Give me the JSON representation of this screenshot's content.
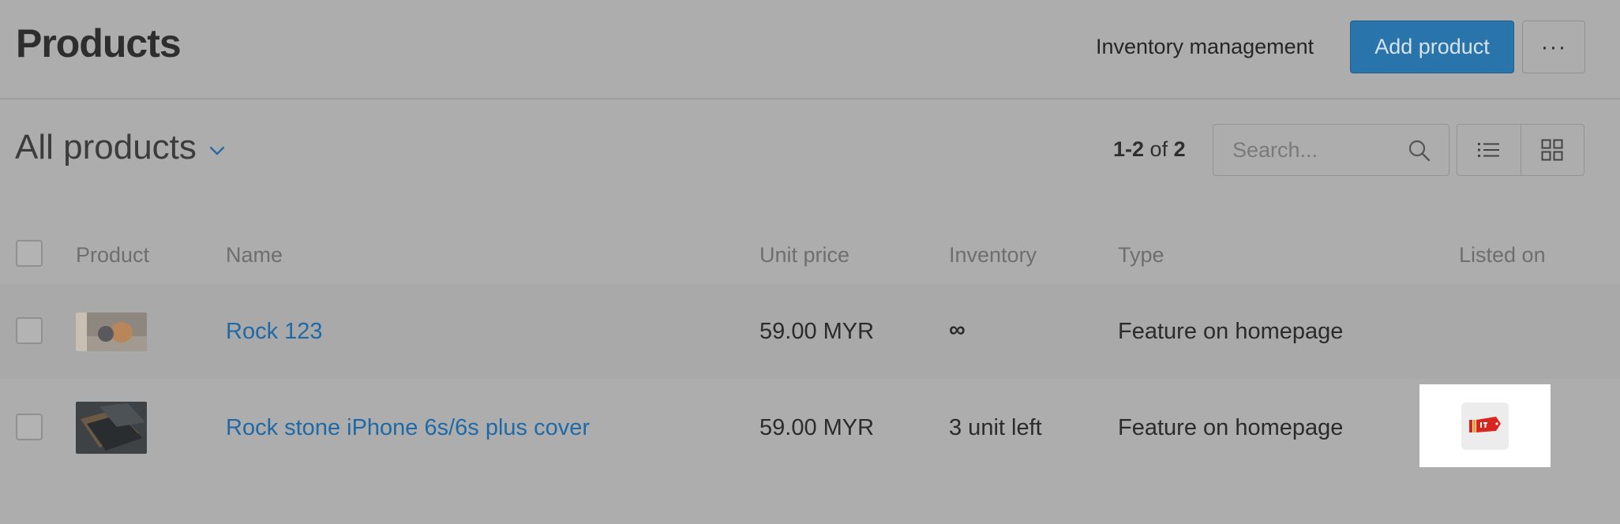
{
  "header": {
    "title": "Products",
    "inventory_link": "Inventory management",
    "add_button": "Add product",
    "more_button": "···"
  },
  "filter": {
    "title": "All products",
    "pager": {
      "range": "1-2",
      "of": "of",
      "total": "2"
    },
    "search_placeholder": "Search..."
  },
  "table": {
    "columns": {
      "product": "Product",
      "name": "Name",
      "unit_price": "Unit price",
      "inventory": "Inventory",
      "type": "Type",
      "listed_on": "Listed on"
    },
    "rows": [
      {
        "name": "Rock 123",
        "unit_price": "59.00 MYR",
        "inventory": "∞",
        "type": "Feature on homepage",
        "listed_on": ""
      },
      {
        "name": "Rock stone iPhone 6s/6s plus cover",
        "unit_price": "59.00 MYR",
        "inventory": "3 unit left",
        "type": "Feature on homepage",
        "listed_on": "channel-logo"
      }
    ]
  },
  "colors": {
    "accent": "#2a74ac",
    "link": "#1f6aa6",
    "overlay_background": "#adadad",
    "channel_red": "#d7261e"
  },
  "icons": {
    "more": "more-icon",
    "chevron": "chevron-down-icon",
    "search": "search-icon",
    "list_view": "list-view-icon",
    "grid_view": "grid-view-icon",
    "channel": "channel-logo-icon"
  }
}
